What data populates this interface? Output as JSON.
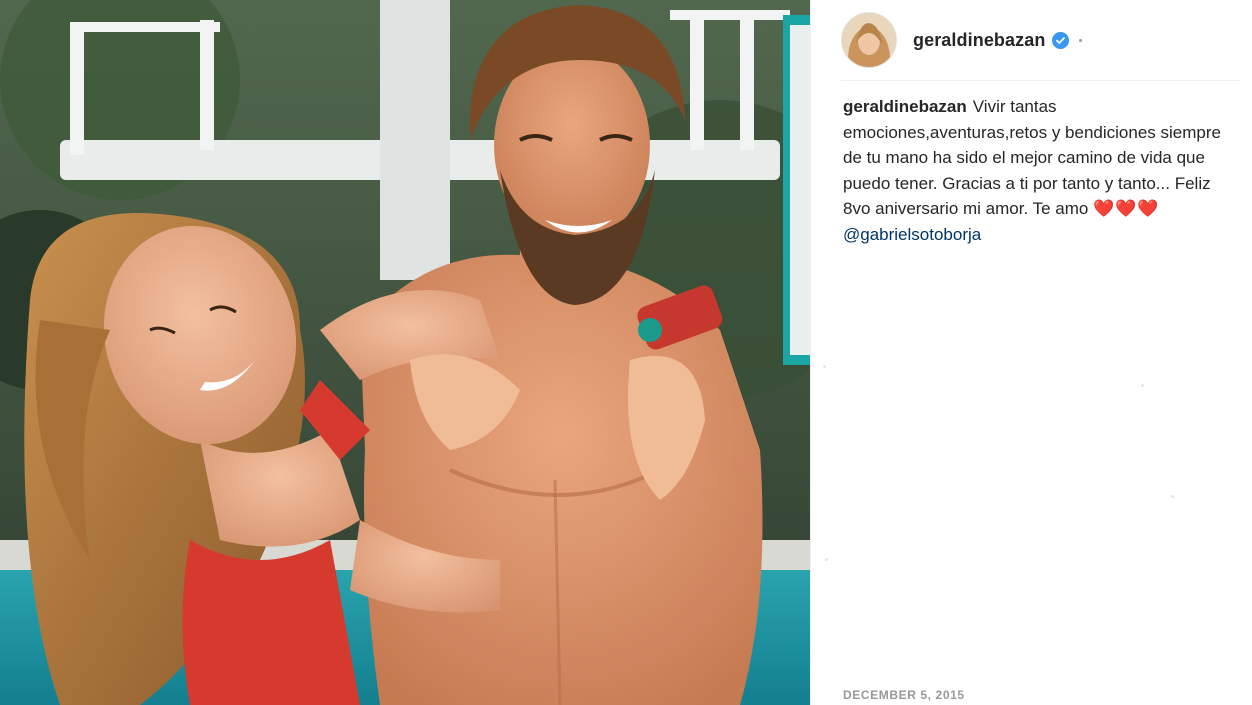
{
  "post": {
    "username": "geraldinebazan",
    "caption_user": "geraldinebazan",
    "caption_text": "Vivir tantas emociones,aventuras,retos y bendiciones siempre de tu mano ha sido el mejor camino de vida que puedo tener. Gracias a ti por tanto y tanto... Feliz 8vo aniversario mi amor. Te amo",
    "caption_hearts": "❤️❤️❤️",
    "mention": "@gabrielsotoborja",
    "date": "DECEMBER 5, 2015"
  },
  "icons": {
    "verified": "verified-badge-icon",
    "heart": "heart-icon"
  },
  "colors": {
    "verified_blue": "#3897f0",
    "mention_blue": "#003569",
    "date_gray": "#999999",
    "heart_red": "#e0245e"
  }
}
